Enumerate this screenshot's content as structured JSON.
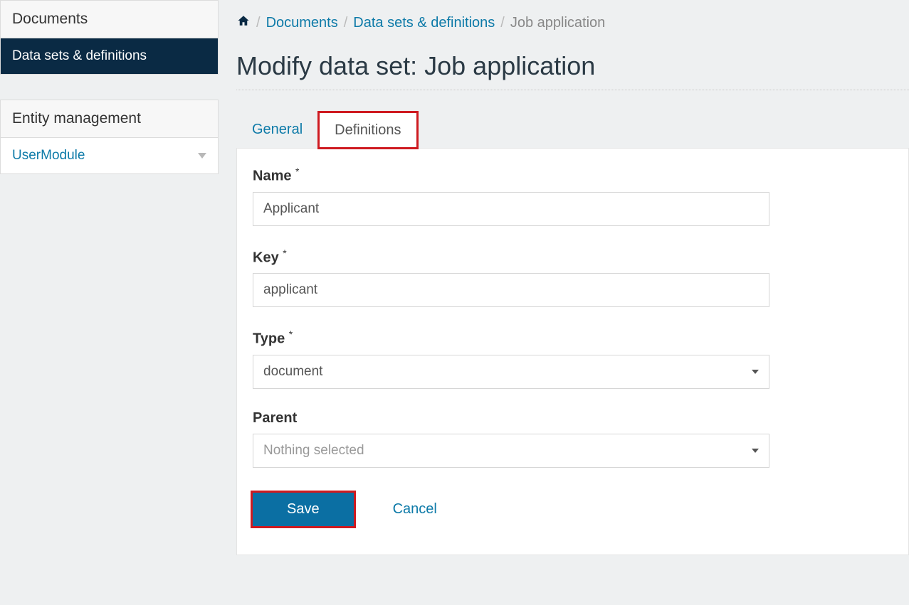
{
  "sidebar": {
    "panel1": {
      "title": "Documents",
      "items": [
        {
          "label": "Data sets & definitions"
        }
      ]
    },
    "panel2": {
      "title": "Entity management",
      "items": [
        {
          "label": "UserModule"
        }
      ]
    }
  },
  "breadcrumb": {
    "items": [
      {
        "label": "Documents"
      },
      {
        "label": "Data sets & definitions"
      }
    ],
    "current": "Job application"
  },
  "page": {
    "title": "Modify data set: Job application"
  },
  "tabs": {
    "general": "General",
    "definitions": "Definitions"
  },
  "form": {
    "name_label": "Name",
    "name_value": "Applicant",
    "key_label": "Key",
    "key_value": "applicant",
    "type_label": "Type",
    "type_value": "document",
    "parent_label": "Parent",
    "parent_value": "Nothing selected",
    "required_mark": "*"
  },
  "actions": {
    "save": "Save",
    "cancel": "Cancel"
  }
}
